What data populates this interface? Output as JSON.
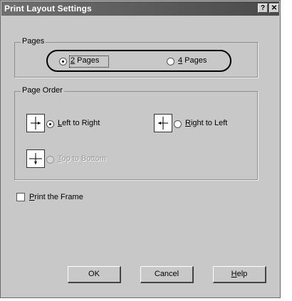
{
  "window": {
    "title": "Print Layout Settings",
    "help_glyph": "?",
    "close_glyph": "✕"
  },
  "pages": {
    "legend": "Pages",
    "options": [
      {
        "label": "2 Pages",
        "mnemonic": "2",
        "rest": " Pages",
        "selected": true
      },
      {
        "label": "4 Pages",
        "mnemonic": "4",
        "rest": " Pages",
        "selected": false
      }
    ]
  },
  "page_order": {
    "legend": "Page Order",
    "options": [
      {
        "label": "Left to Right",
        "mnemonic": "L",
        "rest": "eft to Right",
        "selected": true,
        "enabled": true,
        "icon": "left-to-right-icon"
      },
      {
        "label": "Right to Left",
        "mnemonic": "R",
        "rest": "ight to Left",
        "selected": false,
        "enabled": true,
        "icon": "right-to-left-icon"
      },
      {
        "label": "Top to Bottom",
        "mnemonic": "T",
        "rest": "op to Bottom",
        "selected": false,
        "enabled": false,
        "icon": "top-to-bottom-icon"
      }
    ]
  },
  "print_frame": {
    "label": "Print the Frame",
    "mnemonic": "P",
    "rest": "rint the Frame",
    "checked": false
  },
  "buttons": {
    "ok": "OK",
    "cancel": "Cancel",
    "help_mnemonic": "H",
    "help_rest": "elp"
  },
  "colors": {
    "titlebar": "#5a5a5a",
    "face": "#c8c8c8",
    "highlight_oval": "#000000"
  }
}
